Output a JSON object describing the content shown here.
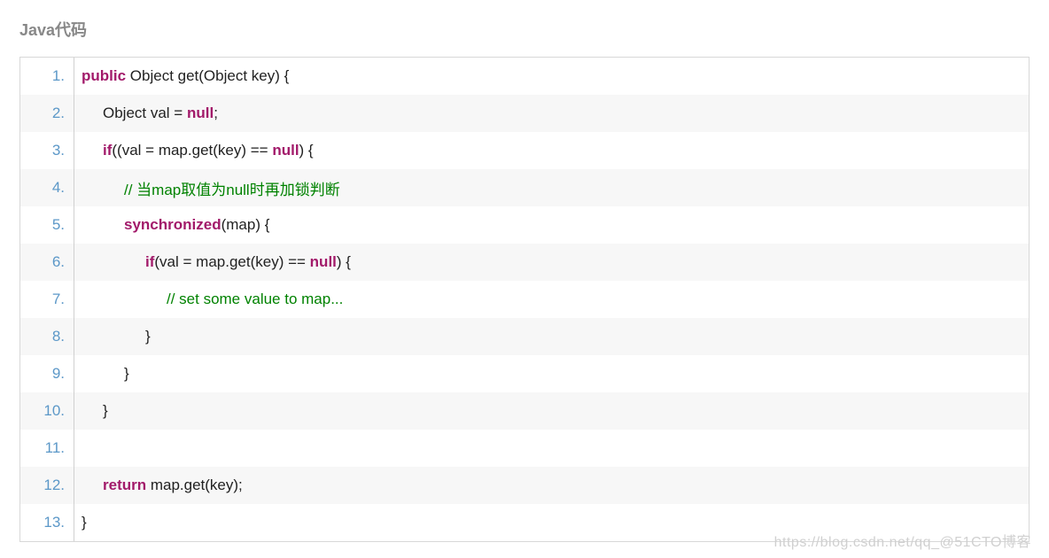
{
  "title": "Java代码",
  "watermark": "https://blog.csdn.net/qq_@51CTO博客",
  "lines": [
    {
      "n": "1.",
      "indent": 0,
      "tokens": [
        {
          "c": "kw",
          "t": "public"
        },
        {
          "c": "txt",
          "t": " Object get(Object key) {  "
        }
      ]
    },
    {
      "n": "2.",
      "indent": 1,
      "tokens": [
        {
          "c": "txt",
          "t": "Object val = "
        },
        {
          "c": "kw",
          "t": "null"
        },
        {
          "c": "txt",
          "t": ";  "
        }
      ]
    },
    {
      "n": "3.",
      "indent": 1,
      "tokens": [
        {
          "c": "kw",
          "t": "if"
        },
        {
          "c": "txt",
          "t": "((val = map.get(key) == "
        },
        {
          "c": "kw",
          "t": "null"
        },
        {
          "c": "txt",
          "t": ") {  "
        }
      ]
    },
    {
      "n": "4.",
      "indent": 2,
      "tokens": [
        {
          "c": "cmt",
          "t": "// 当map取值为null时再加锁判断  "
        }
      ]
    },
    {
      "n": "5.",
      "indent": 2,
      "tokens": [
        {
          "c": "kw",
          "t": "synchronized"
        },
        {
          "c": "txt",
          "t": "(map) {  "
        }
      ]
    },
    {
      "n": "6.",
      "indent": 3,
      "tokens": [
        {
          "c": "kw",
          "t": "if"
        },
        {
          "c": "txt",
          "t": "(val = map.get(key) == "
        },
        {
          "c": "kw",
          "t": "null"
        },
        {
          "c": "txt",
          "t": ") {  "
        }
      ]
    },
    {
      "n": "7.",
      "indent": 4,
      "tokens": [
        {
          "c": "cmt",
          "t": "// set some value to map...  "
        }
      ]
    },
    {
      "n": "8.",
      "indent": 3,
      "tokens": [
        {
          "c": "txt",
          "t": "}  "
        }
      ]
    },
    {
      "n": "9.",
      "indent": 2,
      "tokens": [
        {
          "c": "txt",
          "t": "}  "
        }
      ]
    },
    {
      "n": "10.",
      "indent": 1,
      "tokens": [
        {
          "c": "txt",
          "t": "}  "
        }
      ]
    },
    {
      "n": "11.",
      "indent": 0,
      "tokens": [
        {
          "c": "txt",
          "t": "  "
        }
      ]
    },
    {
      "n": "12.",
      "indent": 1,
      "tokens": [
        {
          "c": "kw",
          "t": "return"
        },
        {
          "c": "txt",
          "t": " map.get(key);  "
        }
      ]
    },
    {
      "n": "13.",
      "indent": 0,
      "tokens": [
        {
          "c": "txt",
          "t": "}  "
        }
      ]
    }
  ]
}
